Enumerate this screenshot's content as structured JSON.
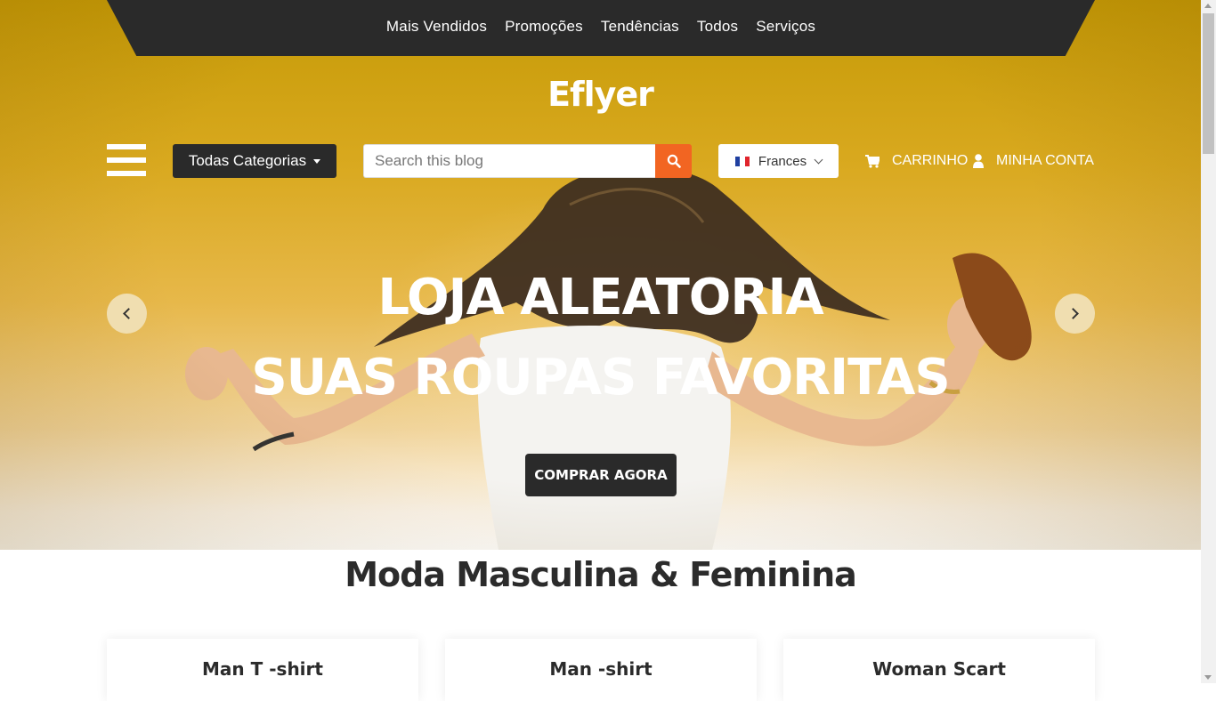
{
  "nav": {
    "items": [
      "Mais Vendidos",
      "Promoções",
      "Tendências",
      "Todos",
      "Serviços"
    ]
  },
  "brand": {
    "logo": "Eflyer"
  },
  "header": {
    "categories_label": "Todas Categorias",
    "search_placeholder": "Search this blog",
    "language": "Frances",
    "cart_label": "CARRINHO",
    "account_label": "MINHA CONTA"
  },
  "hero": {
    "line1": "LOJA ALEATORIA",
    "line2": "SUAS ROUPAS FAVORITAS",
    "cta": "COMPRAR AGORA"
  },
  "section": {
    "title": "Moda Masculina & Feminina",
    "cards": [
      "Man T -shirt",
      "Man -shirt",
      "Woman Scart"
    ]
  },
  "colors": {
    "accent": "#f26522",
    "dark": "#2a2a2a",
    "hero_yellow": "#d9a91f"
  }
}
